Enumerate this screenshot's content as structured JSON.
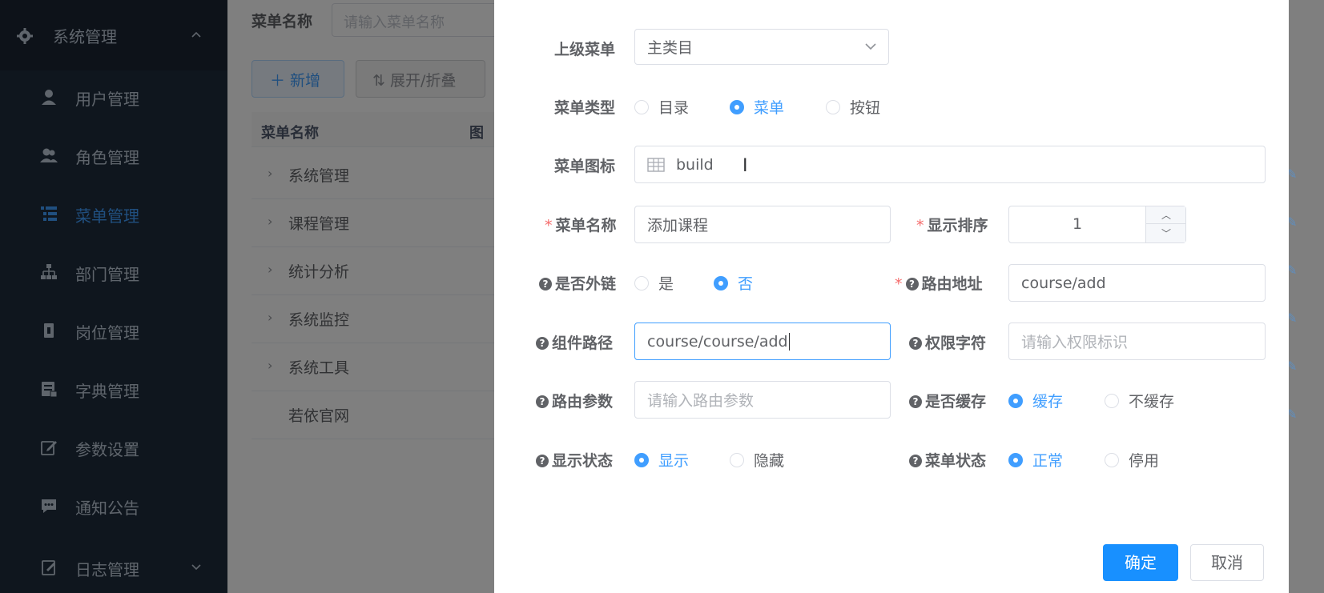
{
  "sidebar": {
    "parent": {
      "label": "系统管理",
      "icon": "gear-icon"
    },
    "items": [
      {
        "label": "用户管理",
        "icon": "user-icon"
      },
      {
        "label": "角色管理",
        "icon": "people-icon"
      },
      {
        "label": "菜单管理",
        "icon": "tree-table-icon",
        "active": true
      },
      {
        "label": "部门管理",
        "icon": "org-tree-icon"
      },
      {
        "label": "岗位管理",
        "icon": "post-icon"
      },
      {
        "label": "字典管理",
        "icon": "dict-icon"
      },
      {
        "label": "参数设置",
        "icon": "edit-icon"
      },
      {
        "label": "通知公告",
        "icon": "message-icon"
      },
      {
        "label": "日志管理",
        "icon": "log-icon"
      }
    ]
  },
  "page": {
    "search_label": "菜单名称",
    "search_placeholder": "请输入菜单名称",
    "add_button": "＋ 新增",
    "toggle_button": "展开/折叠",
    "table": {
      "header_name": "菜单名称",
      "header_icon": "图",
      "rows": [
        "系统管理",
        "课程管理",
        "统计分析",
        "系统监控",
        "系统工具",
        "若依官网"
      ]
    }
  },
  "dialog": {
    "parent_menu": {
      "label": "上级菜单",
      "value": "主类目"
    },
    "menu_type": {
      "label": "菜单类型",
      "options": [
        "目录",
        "菜单",
        "按钮"
      ],
      "selected": "菜单"
    },
    "menu_icon": {
      "label": "菜单图标",
      "value": "build"
    },
    "menu_name": {
      "label": "菜单名称",
      "value": "添加课程"
    },
    "order": {
      "label": "显示排序",
      "value": "1"
    },
    "is_frame": {
      "label": "是否外链",
      "options": [
        "是",
        "否"
      ],
      "selected": "否"
    },
    "route_path": {
      "label": "路由地址",
      "value": "course/add"
    },
    "component": {
      "label": "组件路径",
      "value": "course/course/add"
    },
    "perms": {
      "label": "权限字符",
      "placeholder": "请输入权限标识"
    },
    "query": {
      "label": "路由参数",
      "placeholder": "请输入路由参数"
    },
    "is_cache": {
      "label": "是否缓存",
      "options": [
        "缓存",
        "不缓存"
      ],
      "selected": "缓存"
    },
    "visible": {
      "label": "显示状态",
      "options": [
        "显示",
        "隐藏"
      ],
      "selected": "显示"
    },
    "status": {
      "label": "菜单状态",
      "options": [
        "正常",
        "停用"
      ],
      "selected": "正常"
    },
    "confirm_button": "确定",
    "cancel_button": "取消"
  },
  "colors": {
    "primary": "#1890ff",
    "sidebar_bg": "#1f2d3d",
    "active_text": "#409eff",
    "required": "#f56c6c"
  }
}
